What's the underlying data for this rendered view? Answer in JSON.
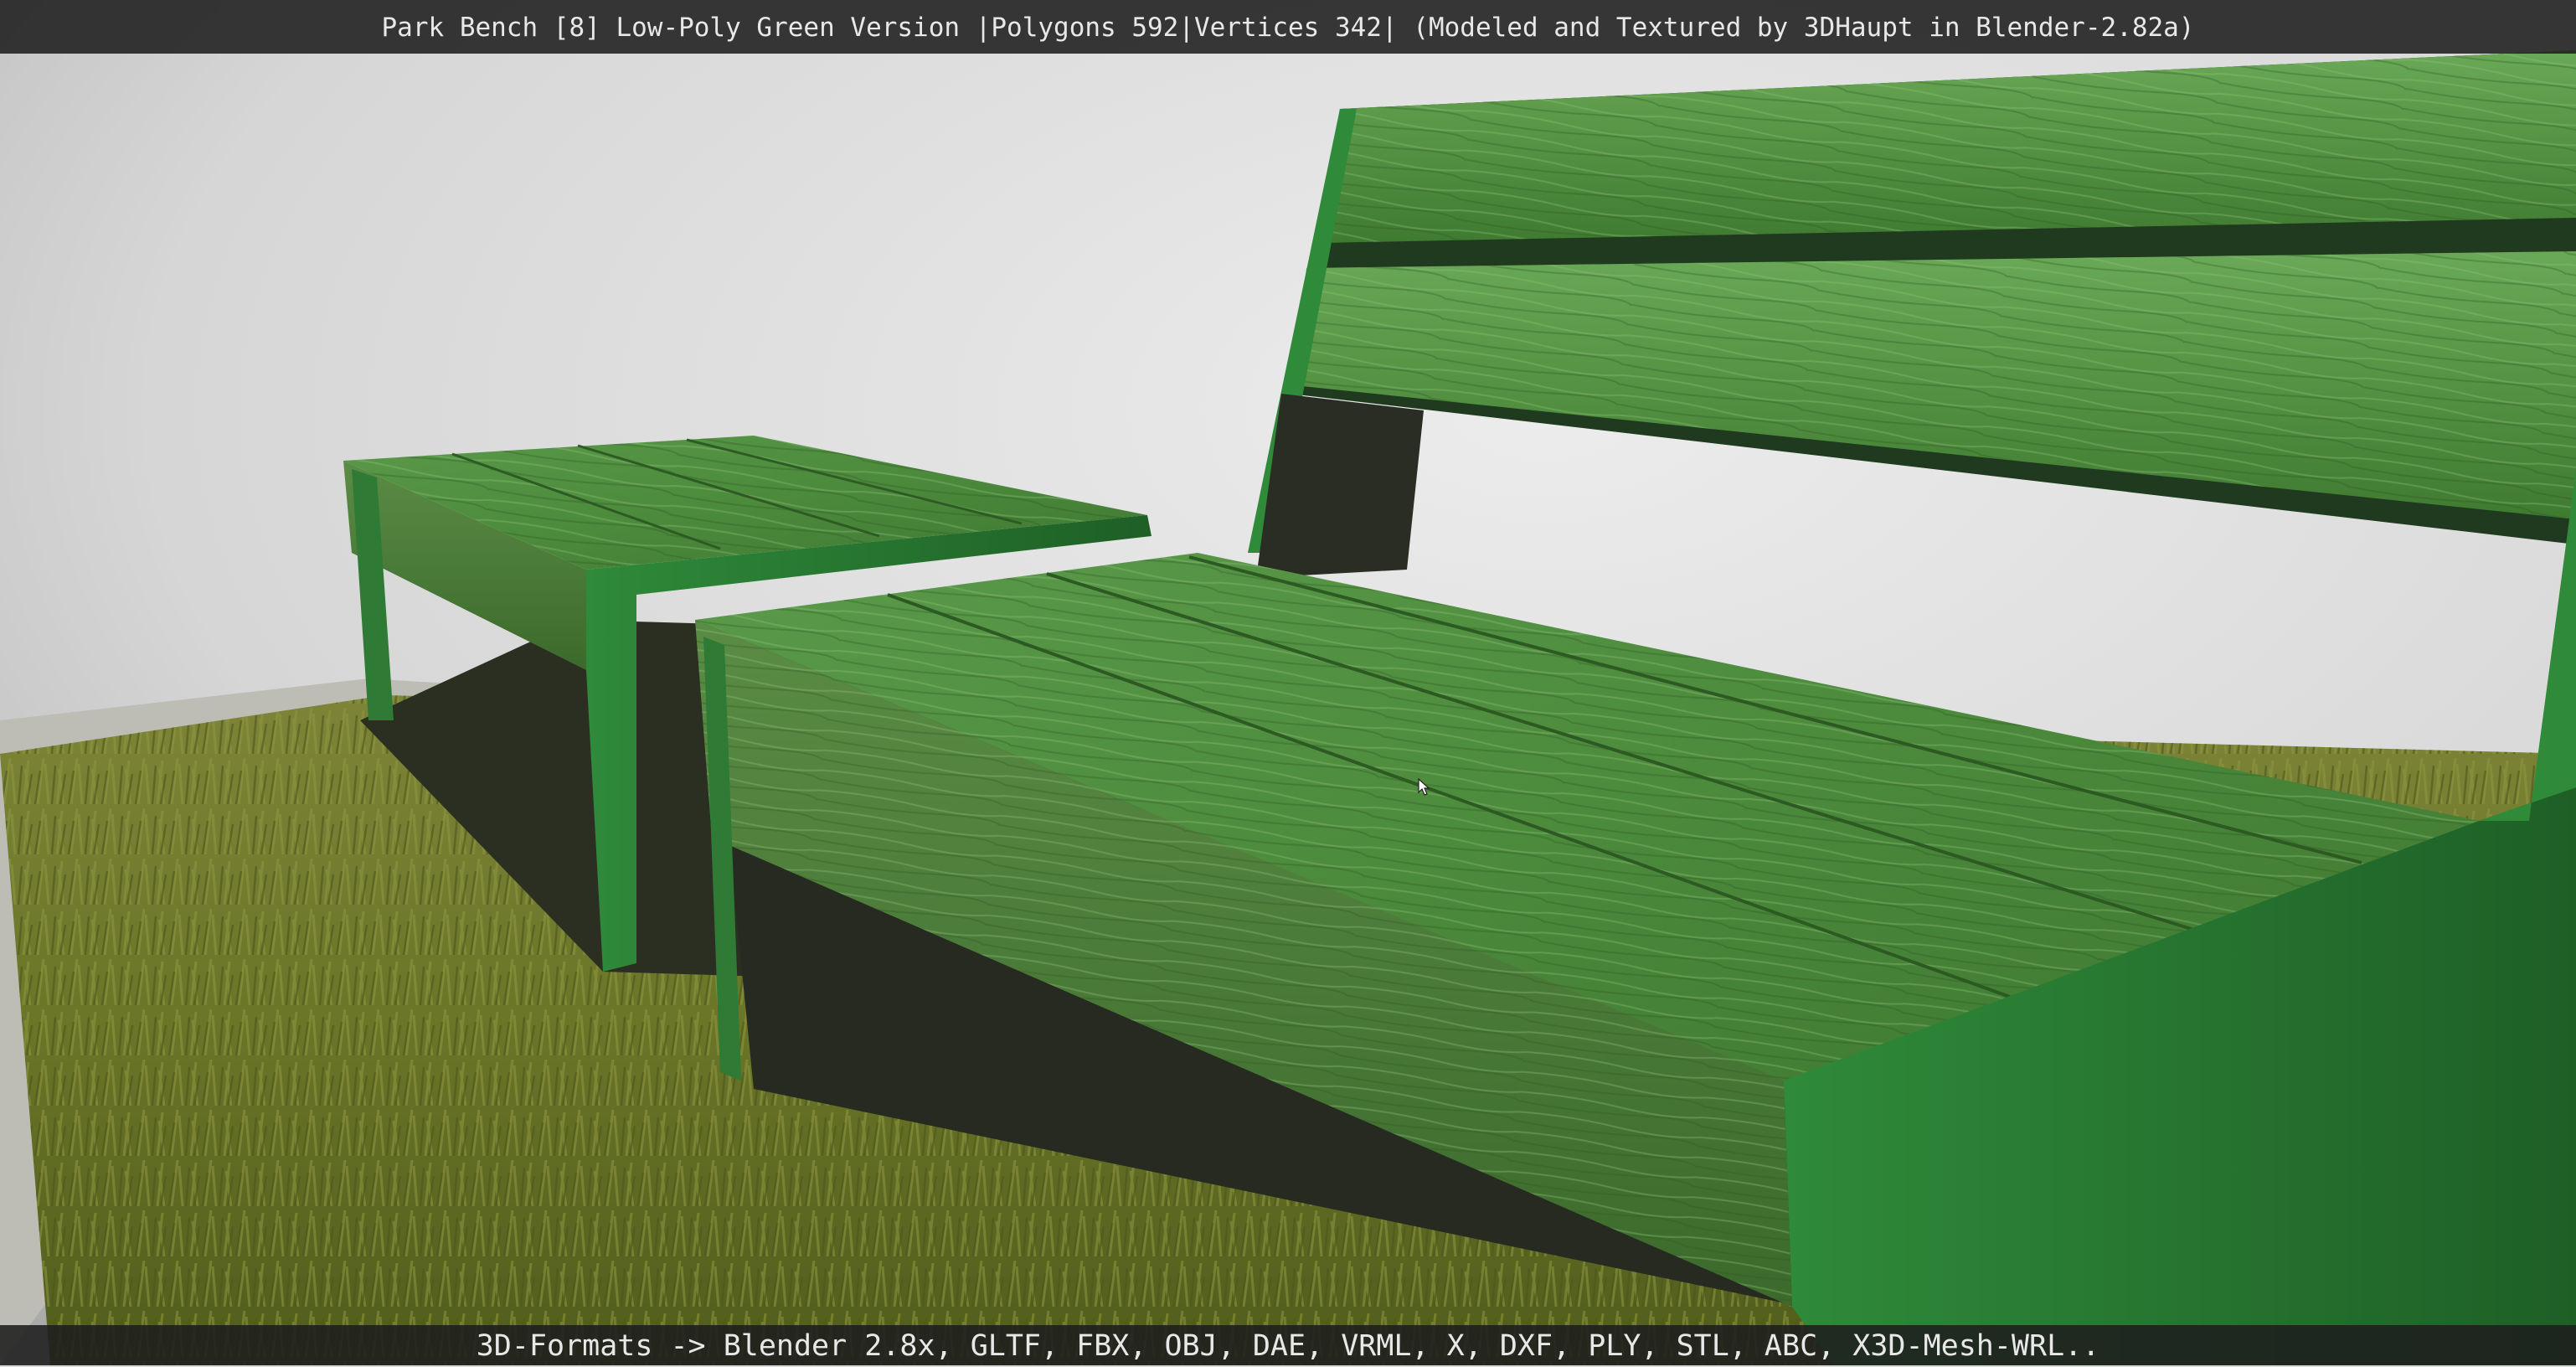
{
  "window": {
    "title": "Park Bench [8] Low-Poly Green Version |Polygons 592|Vertices 342| (Modeled and Textured by 3DHaupt in Blender-2.82a)"
  },
  "status": {
    "formats_text": "3D-Formats -> Blender 2.8x, GLTF, FBX, OBJ, DAE, VRML, X, DXF, PLY, STL, ABC, X3D-Mesh-WRL.."
  },
  "colors": {
    "title_bar_bg": "#1e1e1e",
    "text": "#e8e8e8",
    "bench_green": "#4f8f3c",
    "frame_green": "#2e7d32",
    "grass": "#6e7a2a",
    "backdrop": "#d8d8d8"
  },
  "scene": {
    "subject": "park-bench-3d-render",
    "cursor_icon": "mouse-pointer-icon"
  }
}
